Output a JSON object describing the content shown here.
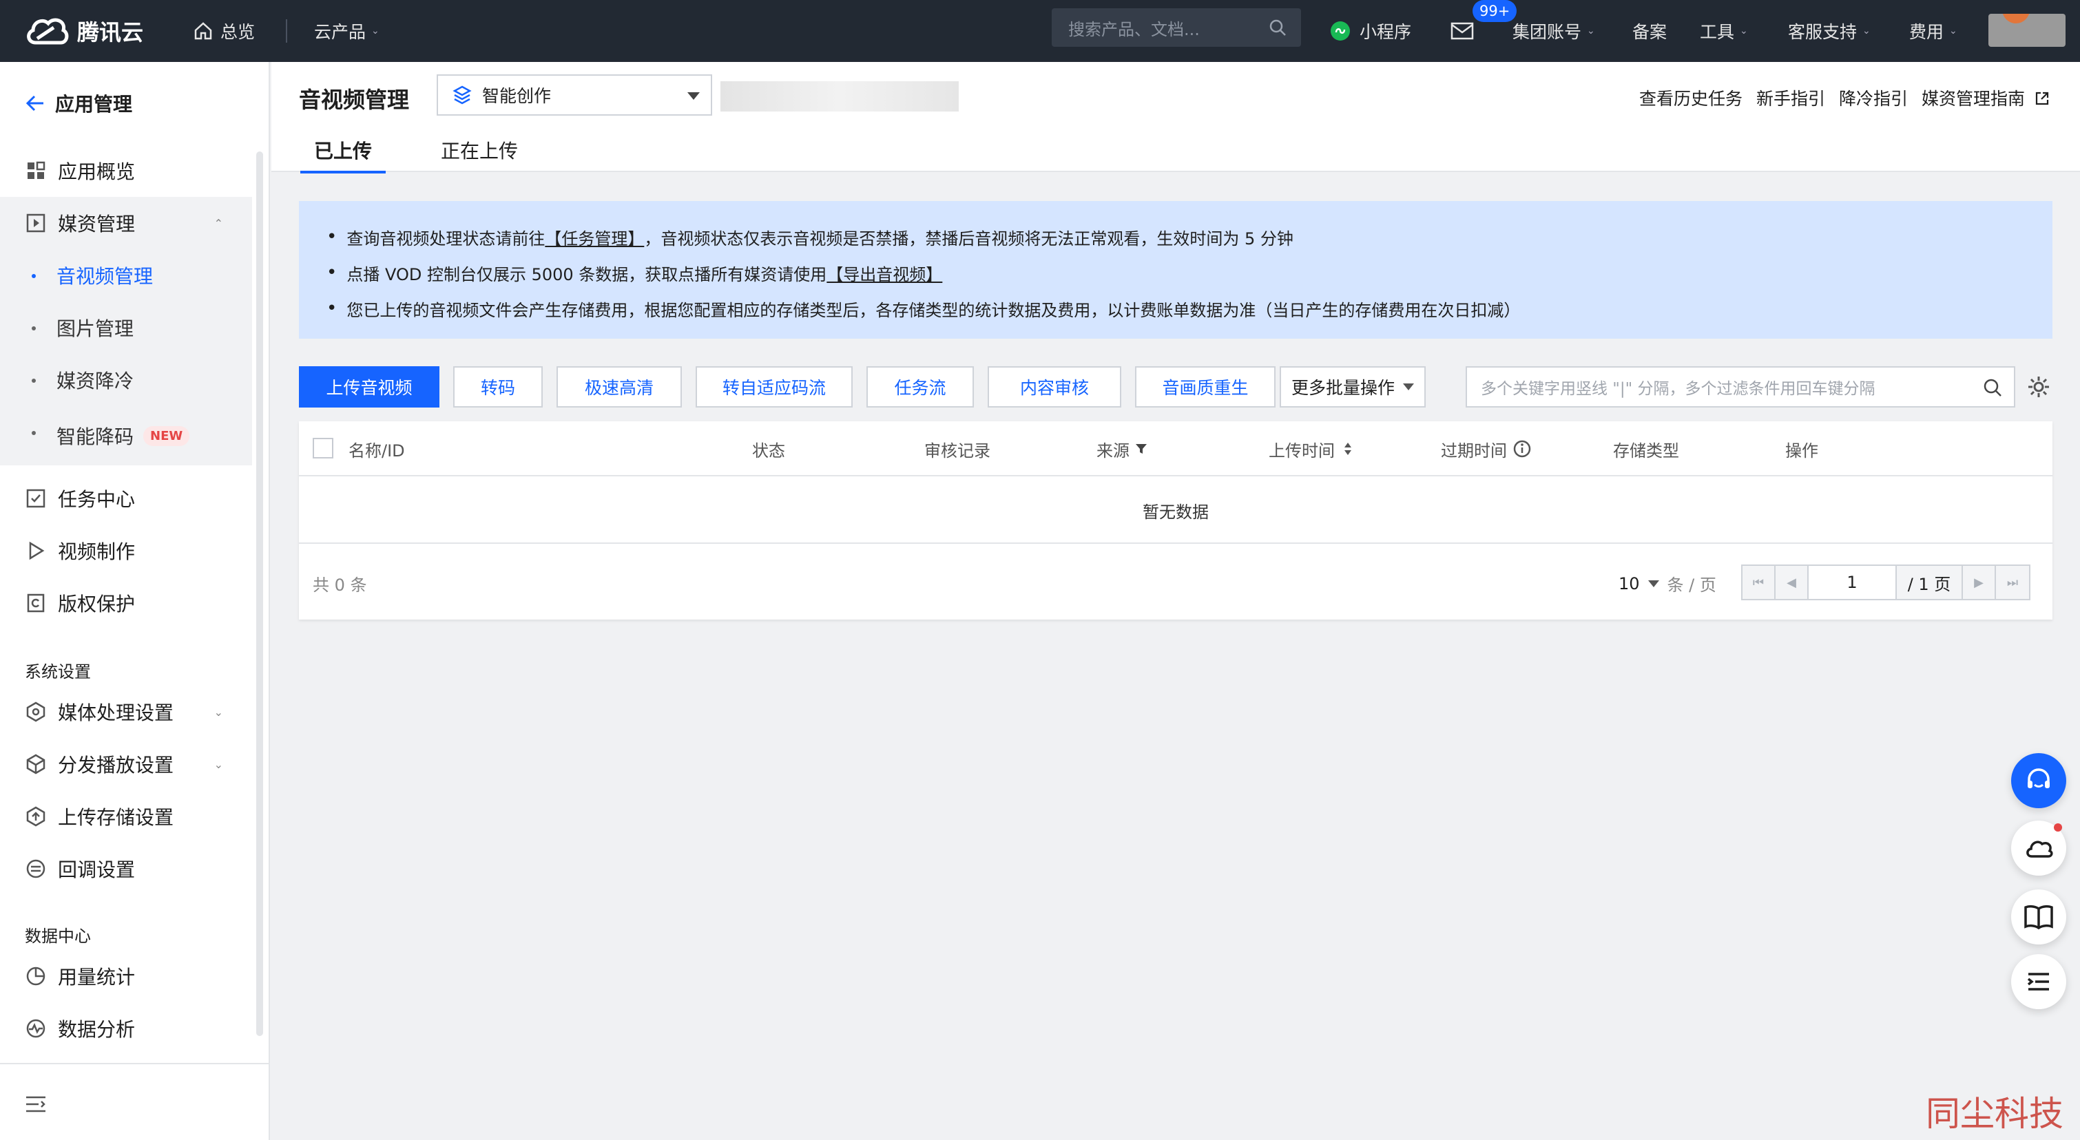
{
  "topbar": {
    "brand": "腾讯云",
    "overview": "总览",
    "products": "云产品",
    "search_placeholder": "搜索产品、文档...",
    "miniprogram": "小程序",
    "mail_badge": "99+",
    "group_account": "集团账号",
    "filing": "备案",
    "tools": "工具",
    "support": "客服支持",
    "billing": "费用"
  },
  "sidebar": {
    "back_title": "应用管理",
    "items": [
      {
        "label": "应用概览"
      },
      {
        "label": "媒资管理"
      },
      {
        "label": "音视频管理"
      },
      {
        "label": "图片管理"
      },
      {
        "label": "媒资降冷"
      },
      {
        "label": "智能降码",
        "badge": "NEW"
      },
      {
        "label": "任务中心"
      },
      {
        "label": "视频制作"
      },
      {
        "label": "版权保护"
      }
    ],
    "group_system": "系统设置",
    "system_items": [
      {
        "label": "媒体处理设置"
      },
      {
        "label": "分发播放设置"
      },
      {
        "label": "上传存储设置"
      },
      {
        "label": "回调设置"
      }
    ],
    "group_data": "数据中心",
    "data_items": [
      {
        "label": "用量统计"
      },
      {
        "label": "数据分析"
      }
    ]
  },
  "header": {
    "title": "音视频管理",
    "app_select": "智能创作",
    "links": [
      "查看历史任务",
      "新手指引",
      "降冷指引",
      "媒资管理指南"
    ],
    "tabs": [
      "已上传",
      "正在上传"
    ]
  },
  "notice": {
    "line1_a": "查询音视频处理状态请前往",
    "line1_link": "【任务管理】",
    "line1_b": "，音视频状态仅表示音视频是否禁播，禁播后音视频将无法正常观看，生效时间为 5 分钟",
    "line2_a": "点播 VOD 控制台仅展示 5000 条数据，获取点播所有媒资请使用",
    "line2_link": "【导出音视频】",
    "line3": "您已上传的音视频文件会产生存储费用，根据您配置相应的存储类型后，各存储类型的统计数据及费用，以计费账单数据为准（当日产生的存储费用在次日扣减）"
  },
  "toolbar": {
    "upload": "上传音视频",
    "transcode": "转码",
    "fast_hd": "极速高清",
    "adaptive": "转自适应码流",
    "taskflow": "任务流",
    "review": "内容审核",
    "remaster": "音画质重生",
    "more": "更多批量操作",
    "filter_placeholder": "多个关键字用竖线 \"|\" 分隔，多个过滤条件用回车键分隔"
  },
  "table": {
    "columns": [
      "名称/ID",
      "状态",
      "审核记录",
      "来源",
      "上传时间",
      "过期时间",
      "存储类型",
      "操作"
    ],
    "empty": "暂无数据",
    "total": "共 0 条",
    "page_size": "10",
    "page_size_unit": "条 / 页",
    "current_page": "1",
    "total_pages": "/ 1 页"
  },
  "watermark": "同尘科技"
}
